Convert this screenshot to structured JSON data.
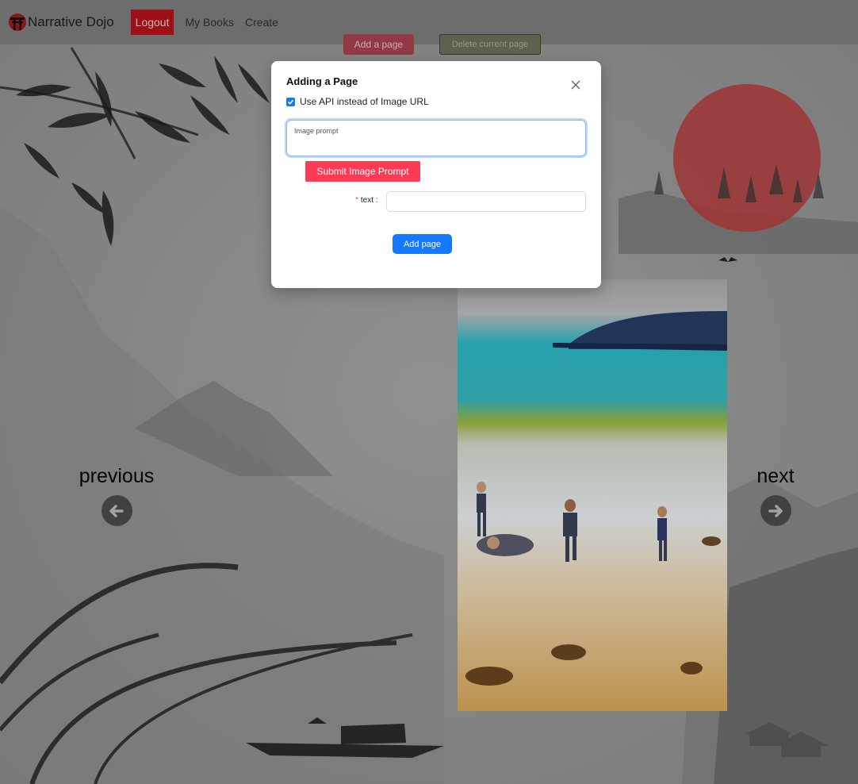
{
  "navbar": {
    "brand": "Narrative Dojo",
    "logout": "Logout",
    "links": [
      "My Books",
      "Create"
    ]
  },
  "toolbar": {
    "add_page": "Add a page",
    "delete_page": "Delete current page"
  },
  "pager": {
    "previous": "previous",
    "next": "next"
  },
  "modal": {
    "title": "Adding a Page",
    "use_api_label": "Use API instead of Image URL",
    "use_api_checked": true,
    "prompt_placeholder": "Image prompt",
    "submit_prompt": "Submit Image Prompt",
    "text_label": "text",
    "text_value": "",
    "add_page": "Add page"
  },
  "colors": {
    "logout_bg": "#b3141a",
    "submit_prompt_bg": "#ff3a55",
    "primary": "#1677ff",
    "sun": "#b53b3b"
  },
  "icons": [
    "torii-logo-icon",
    "close-icon",
    "check-icon",
    "arrow-left-icon",
    "arrow-right-icon"
  ]
}
